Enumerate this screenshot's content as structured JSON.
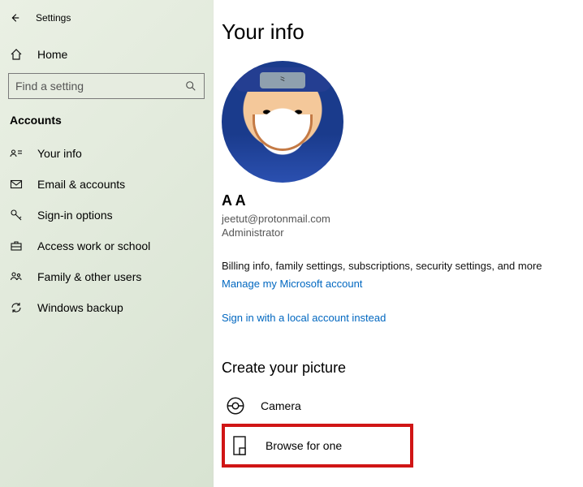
{
  "header": {
    "app_title": "Settings"
  },
  "sidebar": {
    "home_label": "Home",
    "search_placeholder": "Find a setting",
    "section_label": "Accounts",
    "items": [
      {
        "label": "Your info"
      },
      {
        "label": "Email & accounts"
      },
      {
        "label": "Sign-in options"
      },
      {
        "label": "Access work or school"
      },
      {
        "label": "Family & other users"
      },
      {
        "label": "Windows backup"
      }
    ]
  },
  "main": {
    "title": "Your info",
    "display_name": "A A",
    "email": "jeetut@protonmail.com",
    "role": "Administrator",
    "billing_note": "Billing info, family settings, subscriptions, security settings, and more",
    "manage_link": "Manage my Microsoft account",
    "local_account_link": "Sign in with a local account instead",
    "picture_section": "Create your picture",
    "camera_label": "Camera",
    "browse_label": "Browse for one"
  }
}
